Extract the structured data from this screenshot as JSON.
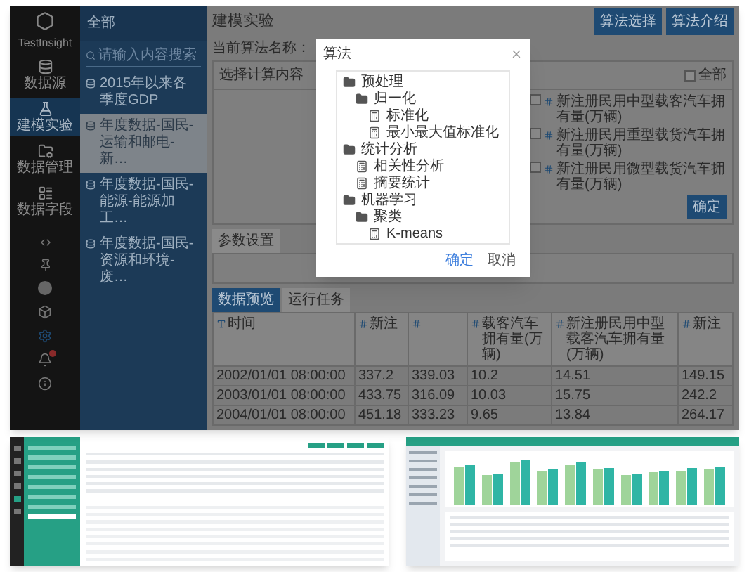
{
  "sidebar": {
    "logo": "TestInsight",
    "items": [
      {
        "label": "数据源",
        "selected": false
      },
      {
        "label": "建模实验",
        "selected": true
      },
      {
        "label": "数据管理",
        "selected": false
      },
      {
        "label": "数据字段",
        "selected": false
      }
    ]
  },
  "list_panel": {
    "title": "全部",
    "search": {
      "placeholder": "请输入内容搜索"
    },
    "items": [
      {
        "label": "2015年以来各季度GDP",
        "selected": false
      },
      {
        "label": "年度数据-国民-运输和邮电-新…",
        "selected": true
      },
      {
        "label": "年度数据-国民-能源-能源加工…",
        "selected": false
      },
      {
        "label": "年度数据-国民-资源和环境-废…",
        "selected": false
      }
    ]
  },
  "main": {
    "title": "建模实验",
    "buttons": [
      "算法选择",
      "算法介绍"
    ],
    "algorithm_label": "当前算法名称：",
    "content_card": {
      "title": "选择计算内容",
      "select_all": {
        "label": "全部",
        "checked": false
      },
      "options": [
        {
          "label": "新注册民用中型载客汽车拥有量(万辆)",
          "checked": false
        },
        {
          "label": "新注册民用重型载货汽车拥有量(万辆)",
          "checked": false
        },
        {
          "label": "新注册民用微型载货汽车拥有量(万辆)",
          "checked": false
        }
      ],
      "confirm": "确定"
    },
    "param_tab": "参数设置",
    "tabs": [
      {
        "label": "数据预览",
        "selected": true
      },
      {
        "label": "运行任务",
        "selected": false
      }
    ],
    "table": {
      "columns": [
        {
          "label": "时间",
          "kind": "text"
        },
        {
          "label": "新注",
          "kind": "number"
        },
        {
          "kind": "number"
        },
        {
          "label": "载客汽车拥有量(万辆)",
          "kind": "number"
        },
        {
          "label": "新注册民用中型载客汽车拥有量(万辆)",
          "kind": "number"
        },
        {
          "label": "新注",
          "kind": "number"
        }
      ],
      "rows": [
        [
          "2002/01/01 08:00:00",
          "337.2",
          "339.03",
          "10.2",
          "14.51",
          "149.15"
        ],
        [
          "2003/01/01 08:00:00",
          "433.75",
          "316.09",
          "10.03",
          "15.75",
          "242.2"
        ],
        [
          "2004/01/01 08:00:00",
          "451.18",
          "333.23",
          "9.65",
          "13.84",
          "264.17"
        ]
      ]
    }
  },
  "modal": {
    "title": "算法",
    "tree": [
      {
        "label": "预处理",
        "kind": "folder",
        "children": [
          {
            "label": "归一化",
            "kind": "folder",
            "children": [
              {
                "label": "标准化",
                "kind": "algorithm"
              },
              {
                "label": "最小最大值标准化",
                "kind": "algorithm"
              }
            ]
          }
        ]
      },
      {
        "label": "统计分析",
        "kind": "folder",
        "children": [
          {
            "label": "相关性分析",
            "kind": "algorithm"
          },
          {
            "label": "摘要统计",
            "kind": "algorithm"
          }
        ]
      },
      {
        "label": "机器学习",
        "kind": "folder",
        "children": [
          {
            "label": "聚类",
            "kind": "folder",
            "children": [
              {
                "label": "K-means",
                "kind": "algorithm"
              }
            ]
          }
        ]
      }
    ],
    "buttons": [
      {
        "label": "确定",
        "kind": "primary"
      },
      {
        "label": "取消",
        "kind": "plain"
      }
    ]
  },
  "thumbnails": [
    {
      "kind": "table_view"
    },
    {
      "kind": "chart_view"
    }
  ]
}
